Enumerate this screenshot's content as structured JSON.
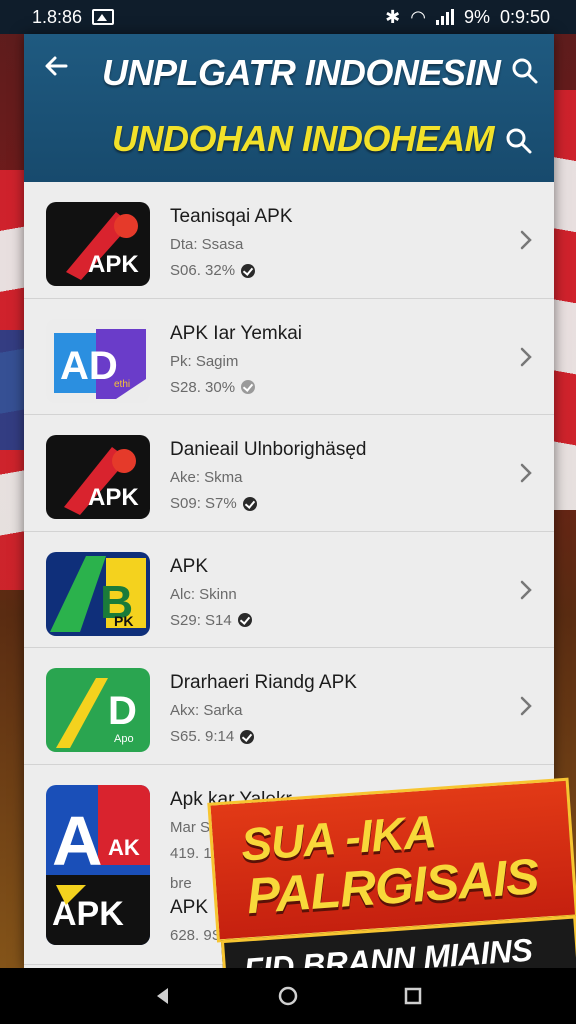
{
  "status_bar": {
    "left_time": "1.8:86",
    "battery": "9%",
    "right_time": "0:9:50"
  },
  "header": {
    "title": "UNPLGATR INDONESIN",
    "subtitle": "UNDOHAN INDOHEAM"
  },
  "apps": [
    {
      "name": "Teanisqai APK",
      "sub": "Dta: Ssasa",
      "size": "S06. 32%",
      "check": "dark",
      "icon": "apk-red"
    },
    {
      "name": "APK Iar Yemkai",
      "sub": "Pk: Sagim",
      "size": "S28. 30%",
      "check": "grey",
      "icon": "ad-blue"
    },
    {
      "name": "Danieail Ulnborighäsęd",
      "sub": "Ake: Skma",
      "size": "S09: S7%",
      "check": "dark",
      "icon": "apk-red2"
    },
    {
      "name": "APK",
      "sub": "Alc: Skinn",
      "size": "S29: S14",
      "check": "dark",
      "icon": "ab-green"
    },
    {
      "name": "Drarhaeri Riandg APK",
      "sub": "Akx: Sarka",
      "size": "S65. 9:14",
      "check": "dark",
      "icon": "d-green"
    },
    {
      "name": "Apk kar Yalekr",
      "sub": "Mar Sarab",
      "size": "419. 112",
      "check": "none",
      "icon": "ak-multi"
    }
  ],
  "last_extra": {
    "label_a": "bre",
    "label_b": "APK",
    "label_c": "628. 9S"
  },
  "promo": {
    "line1": "SUA -IKA",
    "line2": "PALRGISAIS",
    "line3": "FID BRANN MIAINS"
  },
  "colors": {
    "header_bg": "#1f5a80",
    "header_subtitle": "#f2e12a",
    "promo_red": "#e23a16",
    "promo_yellow": "#f8d83a"
  }
}
